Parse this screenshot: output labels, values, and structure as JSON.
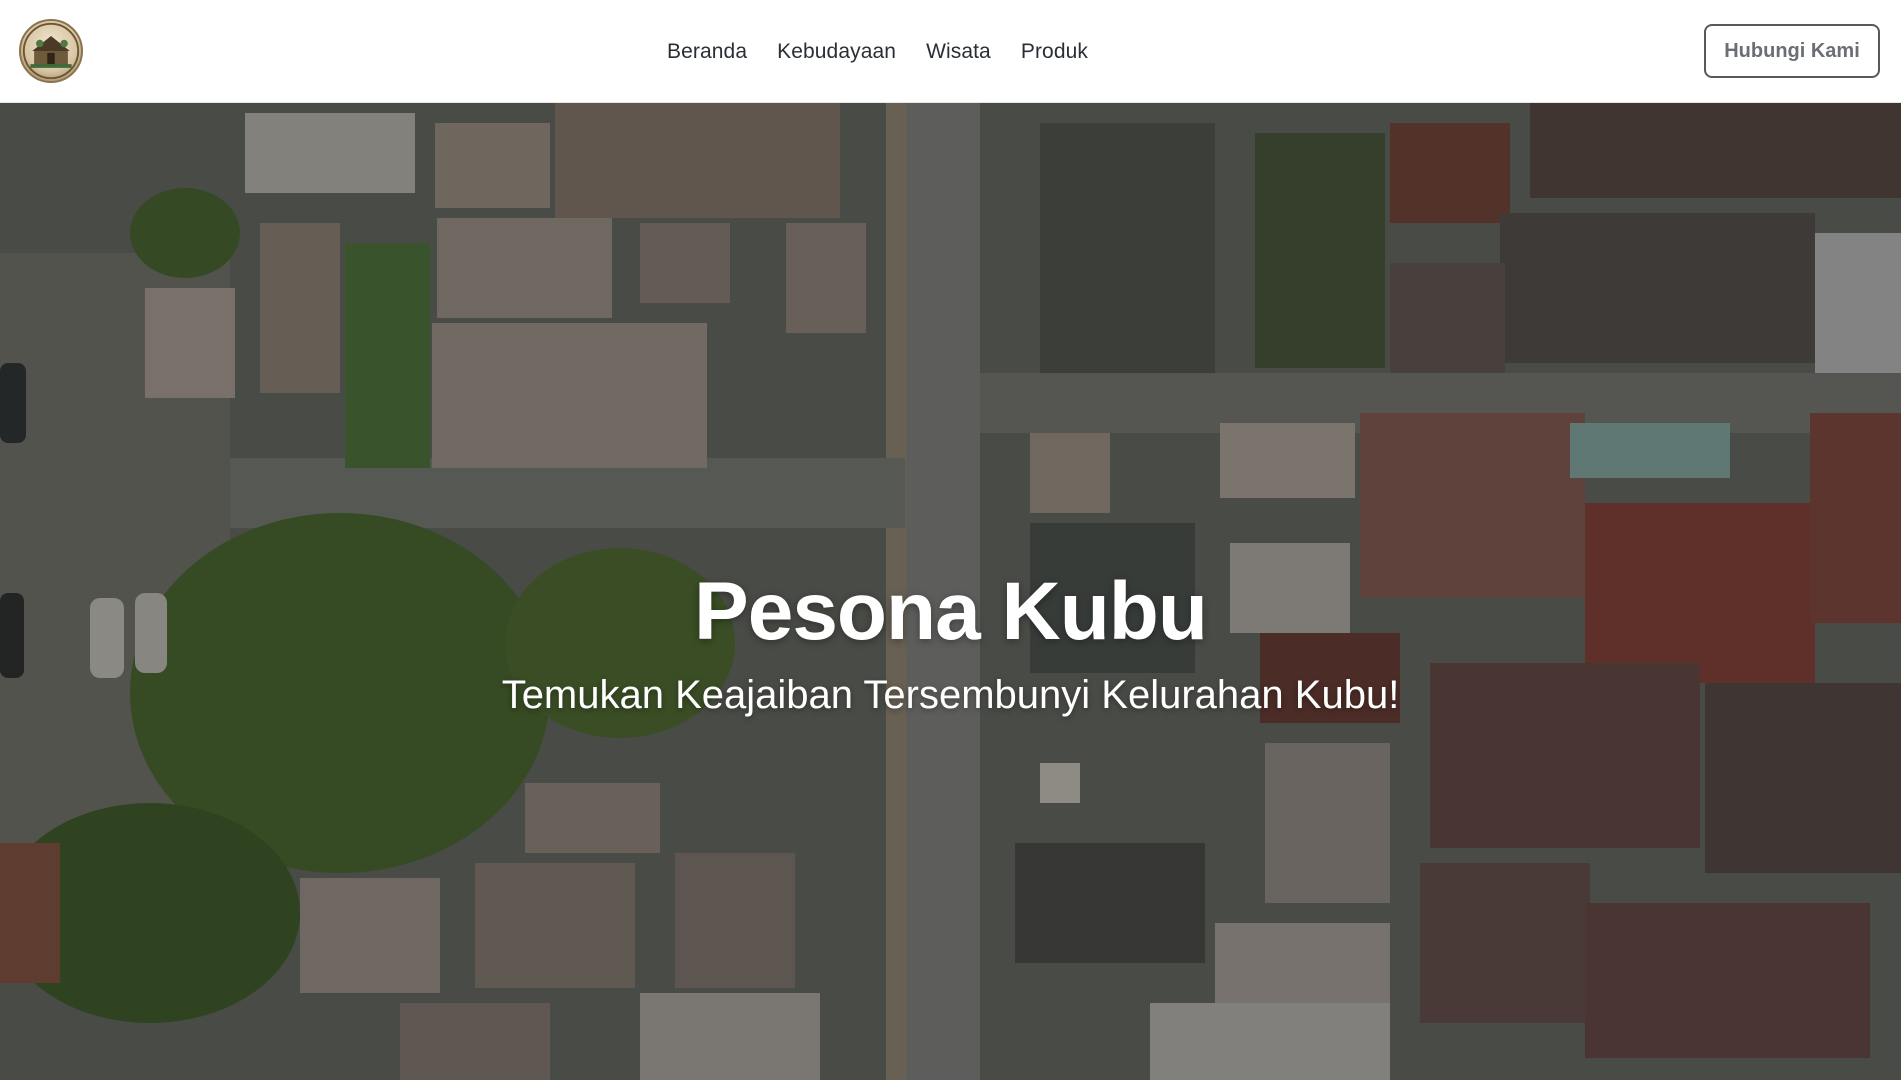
{
  "header": {
    "logo_icon": "village-emblem-icon",
    "nav": [
      {
        "label": "Beranda"
      },
      {
        "label": "Kebudayaan"
      },
      {
        "label": "Wisata"
      },
      {
        "label": "Produk"
      }
    ],
    "contact_label": "Hubungi Kami"
  },
  "hero": {
    "title": "Pesona Kubu",
    "subtitle": "Temukan Keajaiban Tersembunyi Kelurahan Kubu!",
    "background": "aerial-village-photo"
  },
  "colors": {
    "nav_text": "#2a2f36",
    "button_border": "#555a60",
    "button_text": "#6b6f75",
    "hero_text": "#ffffff"
  }
}
